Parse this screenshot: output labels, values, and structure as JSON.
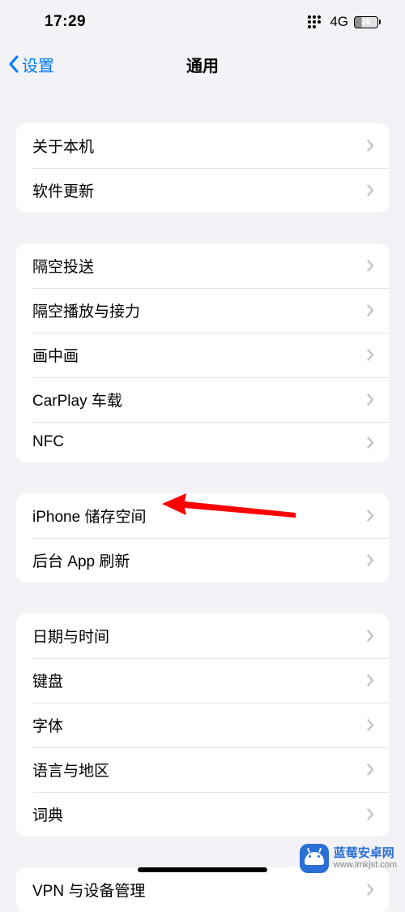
{
  "status": {
    "time": "17:29",
    "network": "4G",
    "battery_pct": "26"
  },
  "nav": {
    "back_label": "设置",
    "title": "通用"
  },
  "groups": [
    {
      "items": [
        {
          "id": "about",
          "label": "关于本机"
        },
        {
          "id": "software-update",
          "label": "软件更新"
        }
      ]
    },
    {
      "items": [
        {
          "id": "airdrop",
          "label": "隔空投送"
        },
        {
          "id": "airplay-handoff",
          "label": "隔空播放与接力"
        },
        {
          "id": "picture-in-picture",
          "label": "画中画"
        },
        {
          "id": "carplay",
          "label": "CarPlay 车载"
        },
        {
          "id": "nfc",
          "label": "NFC"
        }
      ]
    },
    {
      "items": [
        {
          "id": "iphone-storage",
          "label": "iPhone 储存空间"
        },
        {
          "id": "background-app-refresh",
          "label": "后台 App 刷新"
        }
      ]
    },
    {
      "items": [
        {
          "id": "date-time",
          "label": "日期与时间"
        },
        {
          "id": "keyboard",
          "label": "键盘"
        },
        {
          "id": "fonts",
          "label": "字体"
        },
        {
          "id": "language-region",
          "label": "语言与地区"
        },
        {
          "id": "dictionary",
          "label": "词典"
        }
      ]
    },
    {
      "items": [
        {
          "id": "vpn-device-management",
          "label": "VPN 与设备管理"
        }
      ]
    }
  ],
  "annotation": {
    "arrow_color": "#ff0000",
    "target": "iphone-storage"
  },
  "watermark": {
    "title": "蓝莓安卓网",
    "url": "www.lmkjst.com"
  }
}
